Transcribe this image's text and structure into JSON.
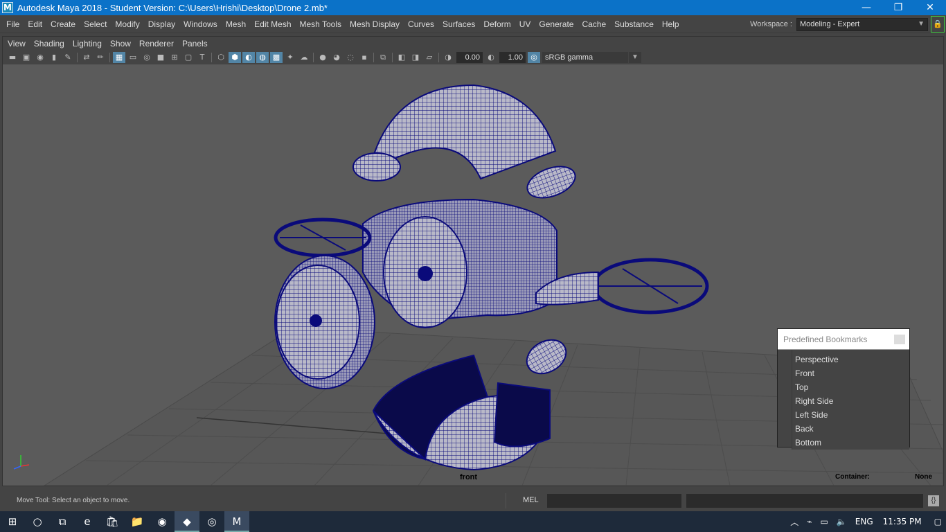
{
  "window": {
    "logo": "M",
    "title": "Autodesk Maya 2018 - Student Version: C:\\Users\\Hrishi\\Desktop\\Drone 2.mb*",
    "minimize_icon": "minimize-icon",
    "restore_icon": "restore-icon",
    "close_icon": "close-icon"
  },
  "menubar": {
    "items": [
      "File",
      "Edit",
      "Create",
      "Select",
      "Modify",
      "Display",
      "Windows",
      "Mesh",
      "Edit Mesh",
      "Mesh Tools",
      "Mesh Display",
      "Curves",
      "Surfaces",
      "Deform",
      "UV",
      "Generate",
      "Cache",
      "Substance",
      "Help"
    ],
    "workspace_label": "Workspace :",
    "workspace_value": "Modeling - Expert"
  },
  "panel": {
    "menu": [
      "View",
      "Shading",
      "Lighting",
      "Show",
      "Renderer",
      "Panels"
    ],
    "exposure": "0.00",
    "gamma": "1.00",
    "color_management": "sRGB gamma",
    "camera_label": "front",
    "container_label": "Container:",
    "container_value": "None"
  },
  "bookmarks": {
    "title": "Predefined Bookmarks",
    "items": [
      "Perspective",
      "Front",
      "Top",
      "Right Side",
      "Left Side",
      "Back",
      "Bottom"
    ]
  },
  "statusbar": {
    "help_line": "Move Tool: Select an object to move.",
    "mel_label": "MEL"
  },
  "taskbar": {
    "language": "ENG",
    "time": "11:35 PM"
  },
  "colors": {
    "titlebar": "#0b72c8",
    "viewport": "#5b5b5b",
    "wireframe": "#0a0a7a",
    "highlight": "#5285a6"
  }
}
